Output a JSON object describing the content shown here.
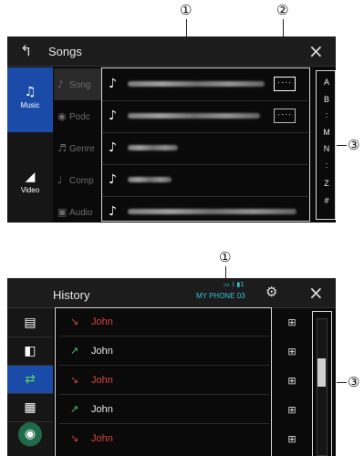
{
  "callouts": {
    "top_1": "①",
    "top_2": "②",
    "top_3": "③",
    "bottom_1": "①",
    "bottom_3": "③"
  },
  "songs_screen": {
    "back_glyph": "↰",
    "title": "Songs",
    "close_glyph": "×",
    "sidebar": [
      {
        "label": "Music",
        "glyph": "♫",
        "active": true
      },
      {
        "label": "Video",
        "glyph": "◢",
        "active": false
      }
    ],
    "categories": [
      {
        "label": "Song",
        "glyph": "♪"
      },
      {
        "label": "Podc",
        "glyph": "◉"
      },
      {
        "label": "Genre",
        "glyph": "♬"
      },
      {
        "label": "Comp",
        "glyph": "♩"
      },
      {
        "label": "Audio",
        "glyph": "▣"
      }
    ],
    "songs": [
      {
        "glyph": "♪",
        "has_more": true
      },
      {
        "glyph": "♪",
        "has_more": true
      },
      {
        "glyph": "♪",
        "has_more": false
      },
      {
        "glyph": "♪",
        "has_more": false
      },
      {
        "glyph": "♪",
        "has_more": false
      }
    ],
    "more_label": "····",
    "alphabet": [
      "A",
      "B",
      ":",
      "M",
      "N",
      ":",
      "Z",
      "#"
    ]
  },
  "history_screen": {
    "title": "History",
    "phone_name": "MY PHONE 03",
    "status_glyphs": "▭ ⌇ ▮1",
    "settings_glyph": "⚙",
    "close_glyph": "×",
    "sidebar": [
      {
        "glyph": "▤",
        "name": "phonebook-icon"
      },
      {
        "glyph": "◧",
        "name": "contacts-icon"
      },
      {
        "glyph": "⇄",
        "name": "call-history-icon"
      },
      {
        "glyph": "▦",
        "name": "keypad-icon"
      },
      {
        "glyph": "◉",
        "name": "voice-icon"
      }
    ],
    "rows": [
      {
        "name": "John",
        "type": "missed",
        "glyph": "↘"
      },
      {
        "name": "John",
        "type": "outgoing",
        "glyph": "↗"
      },
      {
        "name": "John",
        "type": "missed",
        "glyph": "↘"
      },
      {
        "name": "John",
        "type": "outgoing",
        "glyph": "↗"
      },
      {
        "name": "John",
        "type": "missed",
        "glyph": "↘"
      }
    ],
    "add_glyph": "⊞",
    "colors": {
      "missed": "#d9463b",
      "outgoing": "#48c45d",
      "accent": "#1a4ba8"
    }
  }
}
